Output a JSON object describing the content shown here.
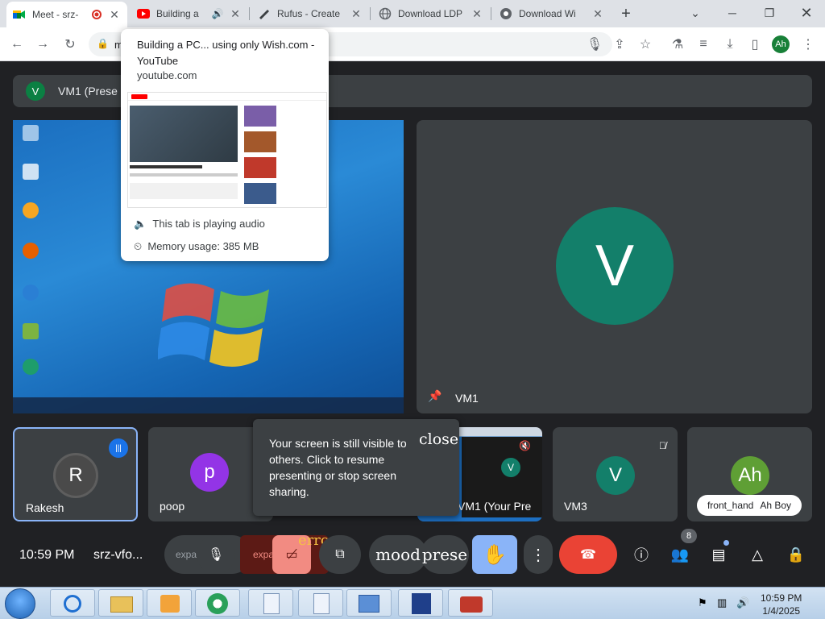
{
  "chrome": {
    "tabs": [
      {
        "label": "Meet - srz-",
        "favicon": "meet-icon",
        "recording": true
      },
      {
        "label": "Building a",
        "favicon": "youtube-icon",
        "audio": true
      },
      {
        "label": "Rufus - Create",
        "favicon": "rufus-icon"
      },
      {
        "label": "Download LDP",
        "favicon": "globe-icon"
      },
      {
        "label": "Download Wi",
        "favicon": "chrome-icon"
      }
    ],
    "new_tab_label": "+",
    "address": "m",
    "profile_initials": "Ah"
  },
  "tab_hover_card": {
    "title": "Building a PC... using only Wish.com - YouTube",
    "domain": "youtube.com",
    "audio_status": "This tab is playing audio",
    "memory": "Memory usage: 385 MB"
  },
  "meet": {
    "presenter_bar": {
      "initial": "V",
      "label": "VM1 (Prese"
    },
    "spotlight": {
      "initial": "V",
      "name": "VM1"
    },
    "participants": [
      {
        "initial": "R",
        "name": "Rakesh",
        "color": "#4a4a4a",
        "speaking": true
      },
      {
        "initial": "p",
        "name": "poop",
        "color": "#9334e6",
        "muted": true
      },
      {
        "initial": "V",
        "name": "VM1 (Your Pre",
        "preview": true,
        "muted": true
      },
      {
        "initial": "V",
        "name": "VM3",
        "color": "#137f6a",
        "muted": true
      },
      {
        "initial": "Ah",
        "name": "Ah Boy",
        "color": "#5f9f35",
        "hand_label": "front_hand"
      }
    ],
    "tooltip": {
      "text": "Your screen is still visible to others. Click to resume presenting or stop screen sharing.",
      "close": "close"
    },
    "controls": {
      "time": "10:59 PM",
      "meeting_code": "srz-vfo...",
      "expand_label": "expa",
      "expand2_label": "expan",
      "error_label": "error",
      "mood_label": "mood",
      "present_label": "prese",
      "people_count": "8"
    }
  },
  "windows": {
    "taskbar_time": "10:59 PM",
    "taskbar_date": "1/4/2025"
  }
}
